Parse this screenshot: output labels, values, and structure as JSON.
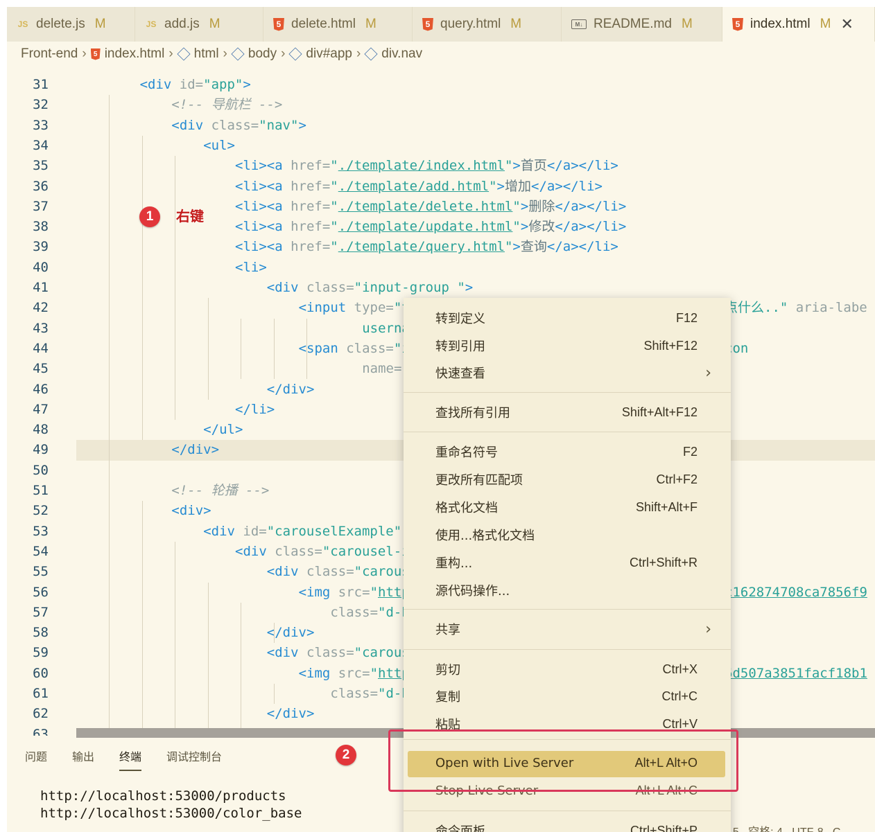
{
  "tabs": [
    {
      "icon": "js-file-icon",
      "label": "delete.js",
      "status": "M",
      "active": false
    },
    {
      "icon": "js-file-icon",
      "label": "add.js",
      "status": "M",
      "active": false
    },
    {
      "icon": "html-file-icon",
      "label": "delete.html",
      "status": "M",
      "active": false
    },
    {
      "icon": "html-file-icon",
      "label": "query.html",
      "status": "M",
      "active": false
    },
    {
      "icon": "markdown-file-icon",
      "label": "README.md",
      "status": "M",
      "active": false
    },
    {
      "icon": "html-file-icon",
      "label": "index.html",
      "status": "M",
      "active": true
    }
  ],
  "tab_close_glyph": "✕",
  "breadcrumb": [
    "Front-end",
    "index.html",
    "html",
    "body",
    "div#app",
    "div.nav"
  ],
  "editor": {
    "lines": [
      {
        "n": "31",
        "parts": [
          [
            "tag",
            "<div "
          ],
          [
            "attr",
            "id="
          ],
          [
            "str",
            "\"app\""
          ],
          [
            "tag",
            ">"
          ]
        ]
      },
      {
        "n": "32",
        "parts": [
          [
            "cmt",
            "<!-- 导航栏 -->"
          ]
        ]
      },
      {
        "n": "33",
        "parts": [
          [
            "tag",
            "<div "
          ],
          [
            "attr",
            "class="
          ],
          [
            "str",
            "\"nav\""
          ],
          [
            "tag",
            ">"
          ]
        ]
      },
      {
        "n": "34",
        "parts": [
          [
            "tag",
            "<ul>"
          ]
        ]
      },
      {
        "n": "35",
        "parts": [
          [
            "tag",
            "<li><a "
          ],
          [
            "attr",
            "href="
          ],
          [
            "str",
            "\""
          ],
          [
            "link",
            "./template/index.html"
          ],
          [
            "str",
            "\""
          ],
          [
            "tag",
            ">"
          ],
          [
            "txt",
            "首页"
          ],
          [
            "tag",
            "</a></li>"
          ]
        ]
      },
      {
        "n": "36",
        "parts": [
          [
            "tag",
            "<li><a "
          ],
          [
            "attr",
            "href="
          ],
          [
            "str",
            "\""
          ],
          [
            "link",
            "./template/add.html"
          ],
          [
            "str",
            "\""
          ],
          [
            "tag",
            ">"
          ],
          [
            "txt",
            "增加"
          ],
          [
            "tag",
            "</a></li>"
          ]
        ]
      },
      {
        "n": "37",
        "parts": [
          [
            "tag",
            "<li><a "
          ],
          [
            "attr",
            "href="
          ],
          [
            "str",
            "\""
          ],
          [
            "link",
            "./template/delete.html"
          ],
          [
            "str",
            "\""
          ],
          [
            "tag",
            ">"
          ],
          [
            "txt",
            "删除"
          ],
          [
            "tag",
            "</a></li>"
          ]
        ]
      },
      {
        "n": "38",
        "parts": [
          [
            "tag",
            "<li><a "
          ],
          [
            "attr",
            "href="
          ],
          [
            "str",
            "\""
          ],
          [
            "link",
            "./template/update.html"
          ],
          [
            "str",
            "\""
          ],
          [
            "tag",
            ">"
          ],
          [
            "txt",
            "修改"
          ],
          [
            "tag",
            "</a></li>"
          ]
        ]
      },
      {
        "n": "39",
        "parts": [
          [
            "tag",
            "<li><a "
          ],
          [
            "attr",
            "href="
          ],
          [
            "str",
            "\""
          ],
          [
            "link",
            "./template/query.html"
          ],
          [
            "str",
            "\""
          ],
          [
            "tag",
            ">"
          ],
          [
            "txt",
            "查询"
          ],
          [
            "tag",
            "</a></li>"
          ]
        ]
      },
      {
        "n": "40",
        "parts": [
          [
            "tag",
            "<li>"
          ]
        ]
      },
      {
        "n": "41",
        "parts": [
          [
            "tag",
            "<div "
          ],
          [
            "attr",
            "class="
          ],
          [
            "str",
            "\"input-group \""
          ],
          [
            "tag",
            ">"
          ]
        ]
      },
      {
        "n": "42",
        "parts": [
          [
            "tag",
            "<input "
          ],
          [
            "attr",
            "type="
          ],
          [
            "str",
            "\"te"
          ]
        ],
        "right": [
          [
            "str",
            "点什么..\""
          ],
          [
            "attr",
            " aria-labe"
          ]
        ]
      },
      {
        "n": "43",
        "parts": [
          [
            "str",
            "usernam"
          ]
        ]
      },
      {
        "n": "44",
        "parts": [
          [
            "tag",
            "<span "
          ],
          [
            "attr",
            "class="
          ],
          [
            "str",
            "\"in"
          ]
        ],
        "right": [
          [
            "str",
            "con"
          ]
        ]
      },
      {
        "n": "45",
        "parts": [
          [
            "attr",
            "name="
          ],
          [
            "str",
            "\"s"
          ]
        ]
      },
      {
        "n": "46",
        "parts": [
          [
            "tag",
            "</div>"
          ]
        ]
      },
      {
        "n": "47",
        "parts": [
          [
            "tag",
            "</li>"
          ]
        ]
      },
      {
        "n": "48",
        "parts": [
          [
            "tag",
            "</ul>"
          ]
        ]
      },
      {
        "n": "49",
        "parts": [
          [
            "tag",
            "</div>"
          ]
        ]
      },
      {
        "n": "50",
        "parts": []
      },
      {
        "n": "51",
        "parts": [
          [
            "cmt",
            "<!-- 轮播 -->"
          ]
        ]
      },
      {
        "n": "52",
        "parts": [
          [
            "tag",
            "<div>"
          ]
        ]
      },
      {
        "n": "53",
        "parts": [
          [
            "tag",
            "<div "
          ],
          [
            "attr",
            "id="
          ],
          [
            "str",
            "\"carouselExample\""
          ],
          [
            "attr",
            " c"
          ]
        ]
      },
      {
        "n": "54",
        "parts": [
          [
            "tag",
            "<div "
          ],
          [
            "attr",
            "class="
          ],
          [
            "str",
            "\"carousel-in"
          ]
        ]
      },
      {
        "n": "55",
        "parts": [
          [
            "tag",
            "<div "
          ],
          [
            "attr",
            "class="
          ],
          [
            "str",
            "\"carouse"
          ]
        ]
      },
      {
        "n": "56",
        "parts": [
          [
            "tag",
            "<img "
          ],
          [
            "attr",
            "src="
          ],
          [
            "str",
            "\""
          ],
          [
            "link",
            "https"
          ]
        ],
        "right": [
          [
            "link",
            "c162874708ca7856f9"
          ]
        ]
      },
      {
        "n": "57",
        "parts": [
          [
            "attr",
            "class="
          ],
          [
            "str",
            "\"d-bl"
          ]
        ]
      },
      {
        "n": "58",
        "parts": [
          [
            "tag",
            "</div>"
          ]
        ]
      },
      {
        "n": "59",
        "parts": [
          [
            "tag",
            "<div "
          ],
          [
            "attr",
            "class="
          ],
          [
            "str",
            "\"carouse"
          ]
        ]
      },
      {
        "n": "60",
        "parts": [
          [
            "tag",
            "<img "
          ],
          [
            "attr",
            "src="
          ],
          [
            "str",
            "\""
          ],
          [
            "link",
            "https"
          ]
        ],
        "right": [
          [
            "link",
            "6d507a3851facf18b1"
          ]
        ]
      },
      {
        "n": "61",
        "parts": [
          [
            "attr",
            "class="
          ],
          [
            "str",
            "\"d-bl"
          ]
        ]
      },
      {
        "n": "62",
        "parts": [
          [
            "tag",
            "</div>"
          ]
        ]
      },
      {
        "n": "63",
        "parts": [
          [
            "tag",
            "<div "
          ],
          [
            "attr",
            "class="
          ],
          [
            "str",
            "\"carouse"
          ]
        ]
      }
    ]
  },
  "annotations": {
    "step1_number": "1",
    "step1_label": "右键",
    "step2_number": "2"
  },
  "context_menu": {
    "items": [
      {
        "label": "转到定义",
        "key": "F12"
      },
      {
        "label": "转到引用",
        "key": "Shift+F12"
      },
      {
        "label": "快速查看",
        "key": "",
        "submenu": true
      },
      {
        "label": "查找所有引用",
        "key": "Shift+Alt+F12"
      },
      {
        "label": "重命名符号",
        "key": "F2"
      },
      {
        "label": "更改所有匹配项",
        "key": "Ctrl+F2"
      },
      {
        "label": "格式化文档",
        "key": "Shift+Alt+F"
      },
      {
        "label": "使用...格式化文档",
        "key": ""
      },
      {
        "label": "重构...",
        "key": "Ctrl+Shift+R"
      },
      {
        "label": "源代码操作...",
        "key": ""
      },
      {
        "label": "共享",
        "key": "",
        "submenu": true
      },
      {
        "label": "剪切",
        "key": "Ctrl+X"
      },
      {
        "label": "复制",
        "key": "Ctrl+C"
      },
      {
        "label": "粘贴",
        "key": "Ctrl+V"
      },
      {
        "label": "Open with Live Server",
        "key": "Alt+L Alt+O",
        "selected": true
      },
      {
        "label": "Stop Live Server",
        "key": "Alt+L Alt+C"
      },
      {
        "label": "命令面板...",
        "key": "Ctrl+Shift+P"
      }
    ],
    "submenu_glyph": "›"
  },
  "panel": {
    "tabs": [
      "问题",
      "输出",
      "终端",
      "调试控制台"
    ],
    "active_tab": "终端",
    "terminal_lines": [
      "http://localhost:53000/products",
      "http://localhost:53000/color_base"
    ]
  },
  "statusbar": {
    "fragment": "l 15   空格: 4   UTF-8   C"
  },
  "colors": {
    "editor_bg": "#fbf7e9",
    "tabbar_bg": "#ece7d5",
    "menu_bg": "#f5efd9",
    "menu_selected": "#e2c97a",
    "annotation_red": "#e2363a",
    "annotation_box": "#d9385a"
  }
}
